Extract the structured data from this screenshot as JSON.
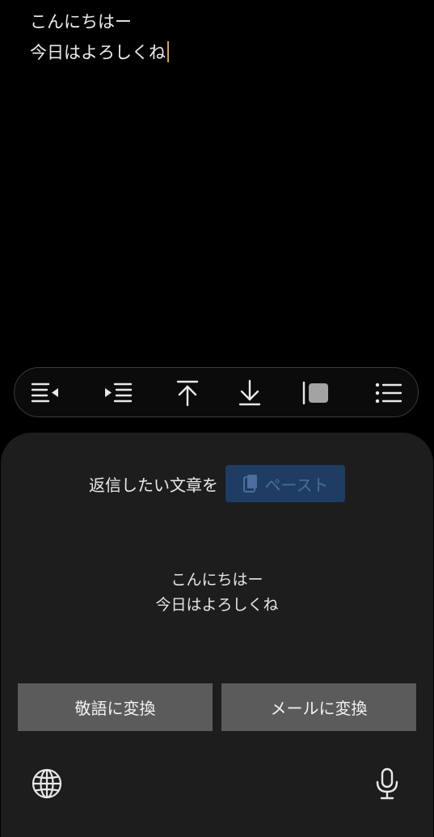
{
  "editor": {
    "lines": [
      "こんにちはー",
      "今日はよろしくね"
    ]
  },
  "toolbar": {
    "buttons": [
      {
        "icon": "align-left-arrow-icon"
      },
      {
        "icon": "indent-arrow-icon"
      },
      {
        "icon": "move-to-top-icon"
      },
      {
        "icon": "move-to-bottom-icon"
      },
      {
        "icon": "color-block-icon"
      },
      {
        "icon": "bullet-list-icon"
      }
    ]
  },
  "panel": {
    "prompt_label": "返信したい文章を",
    "paste_label": "ペースト",
    "preview_lines": [
      "こんにちはー",
      "今日はよろしくね"
    ],
    "honorific_button": "敬語に変換",
    "mail_button": "メールに変換"
  },
  "colors": {
    "background": "#000000",
    "panel": "#1d1d1d",
    "button": "#5b5b5b",
    "paste_button": "#1f3c63",
    "caret": "#d9a441"
  }
}
